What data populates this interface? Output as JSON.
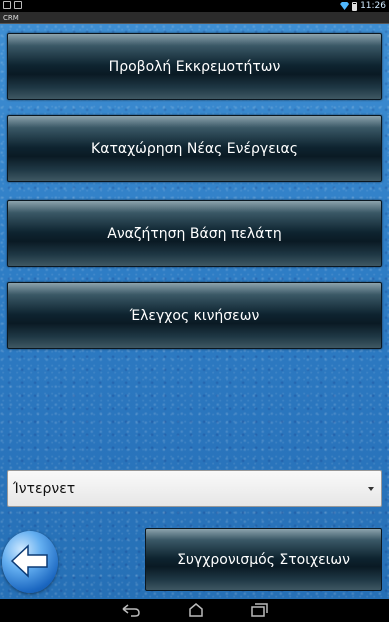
{
  "status_bar": {
    "time": "11:26"
  },
  "app": {
    "title": "CRM"
  },
  "menu": {
    "view_pending": "Προβολή Εκκρεμοτήτων",
    "new_action": "Καταχώρηση Νέας Ενέργειας",
    "search_customer": "Αναζήτηση Βάση πελάτη",
    "movements_check": "Έλεγχος κινήσεων"
  },
  "connection": {
    "selected": "Ίντερνετ"
  },
  "sync": {
    "label": "Συγχρονισμός Στοιχειων"
  },
  "colors": {
    "background": "#2f7ec6",
    "button_dark": "#0e2430",
    "back_blue": "#1a66c0"
  }
}
